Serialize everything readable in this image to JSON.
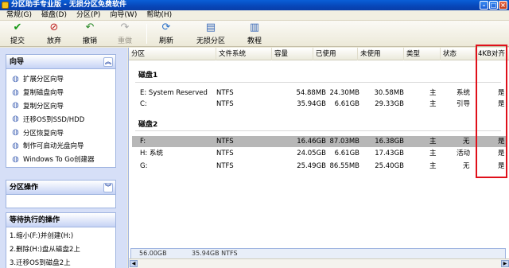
{
  "window": {
    "title": "分区助手专业版 - 无损分区免费软件"
  },
  "menu": [
    "常规(G)",
    "磁盘(D)",
    "分区(P)",
    "向导(W)",
    "帮助(H)"
  ],
  "toolbar": {
    "commit": "提交",
    "discard": "放弃",
    "undo": "撤销",
    "redo": "重做",
    "refresh": "刷新",
    "lossless": "无损分区",
    "tutorial": "教程"
  },
  "wizard": {
    "title": "向导",
    "items": [
      "扩展分区向导",
      "复制磁盘向导",
      "复制分区向导",
      "迁移OS到SSD/HDD",
      "分区恢复向导",
      "制作可启动光盘向导",
      "Windows To Go创建器"
    ]
  },
  "partition_ops": {
    "title": "分区操作"
  },
  "pending": {
    "title": "等待执行的操作",
    "items": [
      "1.缩小(F:)并创建(H:)",
      "2.删除(H:)盘从磁盘2上",
      "3.迁移OS到磁盘2上"
    ]
  },
  "table": {
    "headers": [
      "分区",
      "文件系统",
      "容量",
      "已使用",
      "未使用",
      "类型",
      "状态",
      "4KB对齐"
    ],
    "disks": [
      {
        "title": "磁盘1",
        "rows": [
          {
            "name": "E: System Reserved",
            "fs": "NTFS",
            "capacity": "54.88MB",
            "used": "24.30MB",
            "free": "30.58MB",
            "type": "主",
            "status": "系统",
            "aligned": "是",
            "selected": false
          },
          {
            "name": "C:",
            "fs": "NTFS",
            "capacity": "35.94GB",
            "used": "6.61GB",
            "free": "29.33GB",
            "type": "主",
            "status": "引导",
            "aligned": "是",
            "selected": false
          }
        ]
      },
      {
        "title": "磁盘2",
        "rows": [
          {
            "name": "F:",
            "fs": "NTFS",
            "capacity": "16.46GB",
            "used": "87.03MB",
            "free": "16.38GB",
            "type": "主",
            "status": "无",
            "aligned": "是",
            "selected": true
          },
          {
            "name": "H: 系统",
            "fs": "NTFS",
            "capacity": "24.05GB",
            "used": "6.61GB",
            "free": "17.43GB",
            "type": "主",
            "status": "活动",
            "aligned": "是",
            "selected": false
          },
          {
            "name": "G:",
            "fs": "NTFS",
            "capacity": "25.49GB",
            "used": "86.55MB",
            "free": "25.40GB",
            "type": "主",
            "status": "无",
            "aligned": "是",
            "selected": false
          }
        ]
      }
    ]
  },
  "diskmap": {
    "left": "56.00GB",
    "right": "35.94GB NTFS"
  }
}
